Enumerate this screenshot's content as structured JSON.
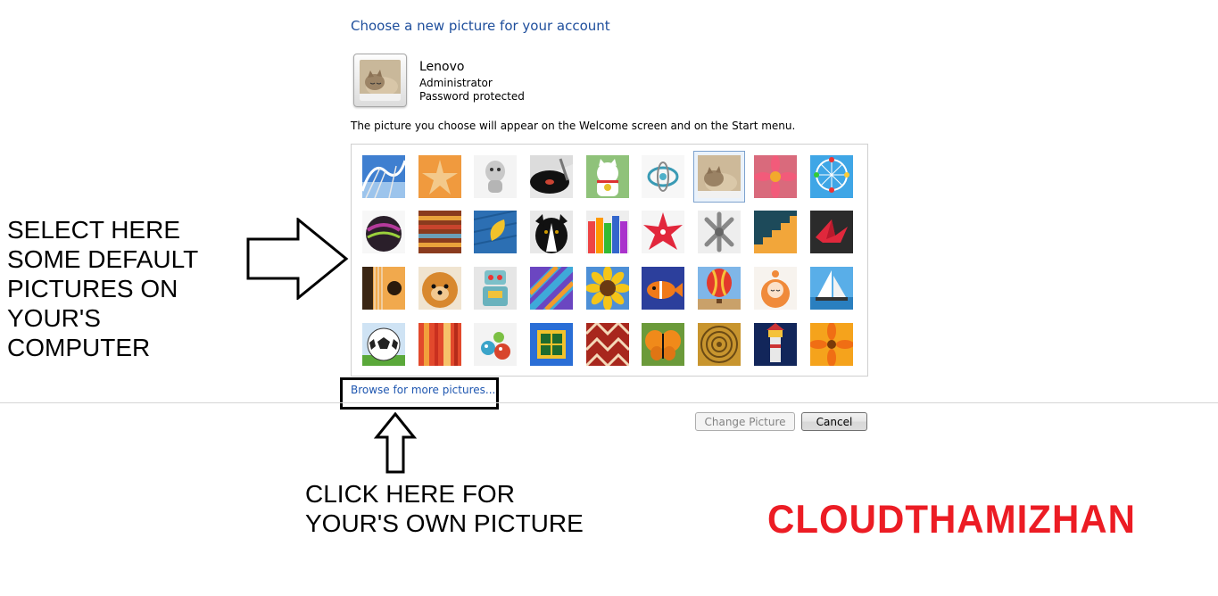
{
  "dialog": {
    "title": "Choose a new picture for your account",
    "account": {
      "name": "Lenovo",
      "role": "Administrator",
      "password_status": "Password protected"
    },
    "description": "The picture you choose will appear on the Welcome screen and on the Start menu.",
    "browse_link": "Browse for more pictures...",
    "buttons": {
      "change_picture": "Change Picture",
      "cancel": "Cancel"
    },
    "selected_picture": "kitten"
  },
  "pictures": [
    "roller-coaster",
    "starfish",
    "robot-dog",
    "turntable",
    "lucky-cat",
    "gyroscope",
    "kitten",
    "pink-flower",
    "ferris-wheel",
    "ball",
    "fabric",
    "leaf",
    "dog",
    "crayons",
    "paper-star",
    "jacks",
    "stairs",
    "paper-crane",
    "guitar",
    "puppy",
    "toy-robot",
    "scarf",
    "sunflower",
    "fish",
    "hot-air-balloon",
    "doll",
    "sailboat",
    "soccer-ball",
    "cloth",
    "marbles",
    "window",
    "rug",
    "butterfly",
    "spiral",
    "lighthouse",
    "orange-flower"
  ],
  "annotations": {
    "left_note": "SELECT HERE\nSOME DEFAULT\nPICTURES ON\nYOUR'S\nCOMPUTER",
    "bottom_note": "CLICK HERE FOR\nYOUR'S OWN PICTURE",
    "brand": "CLOUDTHAMIZHAN"
  },
  "colors": {
    "title_blue": "#1e4e9c",
    "link_blue": "#1e56b0",
    "brand_red": "#ec1c24"
  }
}
